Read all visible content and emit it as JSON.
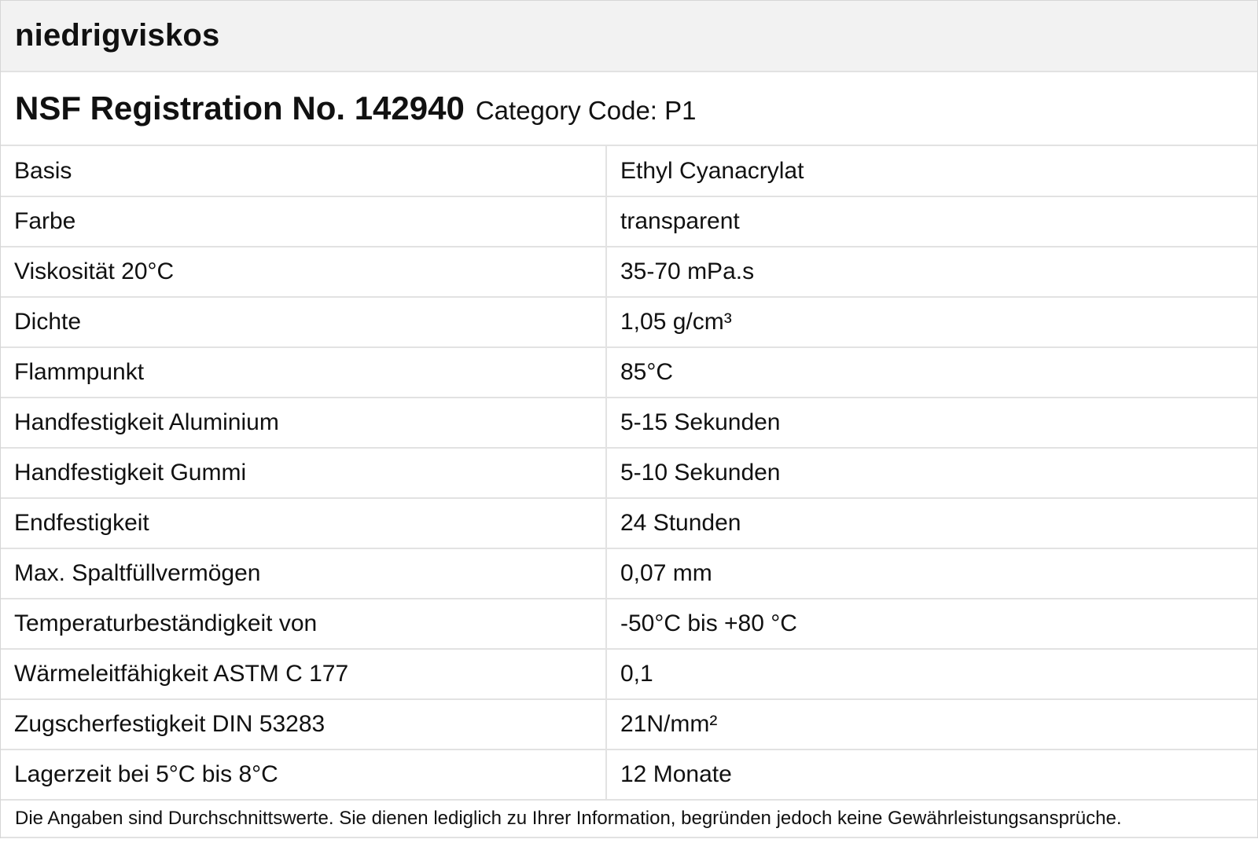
{
  "header": {
    "title": "niedrigviskos"
  },
  "registration": {
    "main": "NSF Registration No. 142940",
    "sub": "Category Code: P1"
  },
  "properties": [
    {
      "label": "Basis",
      "value": "Ethyl Cyanacrylat"
    },
    {
      "label": "Farbe",
      "value": "transparent"
    },
    {
      "label": "Viskosität  20°C",
      "value": "35-70 mPa.s"
    },
    {
      "label": "Dichte",
      "value": "1,05 g/cm³"
    },
    {
      "label": "Flammpunkt",
      "value": "85°C"
    },
    {
      "label": "Handfestigkeit Aluminium",
      "value": "5-15 Sekunden"
    },
    {
      "label": "Handfestigkeit Gummi",
      "value": "5-10 Sekunden"
    },
    {
      "label": "Endfestigkeit",
      "value": "24 Stunden"
    },
    {
      "label": "Max. Spaltfüllvermögen",
      "value": "0,07 mm"
    },
    {
      "label": "Temperaturbeständigkeit von",
      "value": "-50°C bis +80 °C"
    },
    {
      "label": "Wärmeleitfähigkeit ASTM C 177",
      "value": "0,1"
    },
    {
      "label": "Zugscherfestigkeit DIN 53283",
      "value": "21N/mm²"
    },
    {
      "label": "Lagerzeit bei 5°C bis 8°C",
      "value": "12 Monate"
    }
  ],
  "footer": {
    "note": "Die Angaben sind Durchschnittswerte. Sie dienen lediglich zu Ihrer Information, begründen jedoch keine Gewährleistungsansprüche."
  }
}
